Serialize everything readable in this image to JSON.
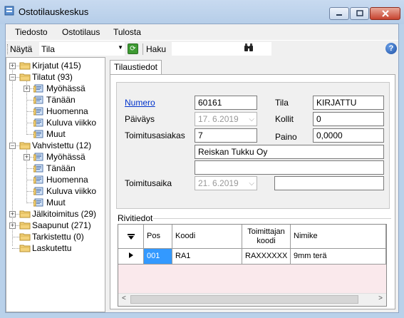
{
  "window": {
    "title": "Ostotilauskeskus"
  },
  "menu": {
    "items": [
      "Tiedosto",
      "Ostotilaus",
      "Tulosta"
    ]
  },
  "toolbar": {
    "show_label": "Näytä",
    "show_value": "Tila",
    "search_label": "Haku",
    "search_value": ""
  },
  "tree": {
    "nodes": [
      {
        "label": "Kirjatut (415)",
        "level": 0,
        "expander": "+"
      },
      {
        "label": "Tilatut (93)",
        "level": 0,
        "expander": "-"
      },
      {
        "label": "Myöhässä",
        "level": 1,
        "expander": "+"
      },
      {
        "label": "Tänään",
        "level": 1,
        "expander": ""
      },
      {
        "label": "Huomenna",
        "level": 1,
        "expander": ""
      },
      {
        "label": "Kuluva viikko",
        "level": 1,
        "expander": ""
      },
      {
        "label": "Muut",
        "level": 1,
        "expander": ""
      },
      {
        "label": "Vahvistettu (12)",
        "level": 0,
        "expander": "-"
      },
      {
        "label": "Myöhässä",
        "level": 1,
        "expander": "+"
      },
      {
        "label": "Tänään",
        "level": 1,
        "expander": ""
      },
      {
        "label": "Huomenna",
        "level": 1,
        "expander": ""
      },
      {
        "label": "Kuluva viikko",
        "level": 1,
        "expander": ""
      },
      {
        "label": "Muut",
        "level": 1,
        "expander": ""
      },
      {
        "label": "Jälkitoimitus (29)",
        "level": 0,
        "expander": "+"
      },
      {
        "label": "Saapunut (271)",
        "level": 0,
        "expander": "+"
      },
      {
        "label": "Tarkistettu (0)",
        "level": 0,
        "expander": ""
      },
      {
        "label": "Laskutettu",
        "level": 0,
        "expander": ""
      }
    ]
  },
  "tab": {
    "label": "Tilaustiedot"
  },
  "form": {
    "numero_label": "Numero",
    "numero_value": "60161",
    "tila_label": "Tila",
    "tila_value": "KIRJATTU",
    "paivays_label": "Päiväys",
    "paivays_value": "17. 6.2019",
    "kollit_label": "Kollit",
    "kollit_value": "0",
    "toimitusasiakas_label": "Toimitusasiakas",
    "toimitusasiakas_value": "7",
    "paino_label": "Paino",
    "paino_value": "0,0000",
    "asiakas_nimi": "Reiskan Tukku Oy",
    "asiakas_lisa": "",
    "toimitusaika_label": "Toimitusaika",
    "toimitusaika_value": "21. 6.2019",
    "toimitusaika_extra": ""
  },
  "rows_section": {
    "title": "Rivitiedot",
    "columns": [
      "Pos",
      "Koodi",
      "Toimittajan koodi",
      "Nimike"
    ],
    "rows": [
      {
        "pos": "001",
        "koodi": "RA1",
        "toimittajan_koodi": "RAXXXXXX",
        "nimike": "9mm terä"
      }
    ]
  }
}
